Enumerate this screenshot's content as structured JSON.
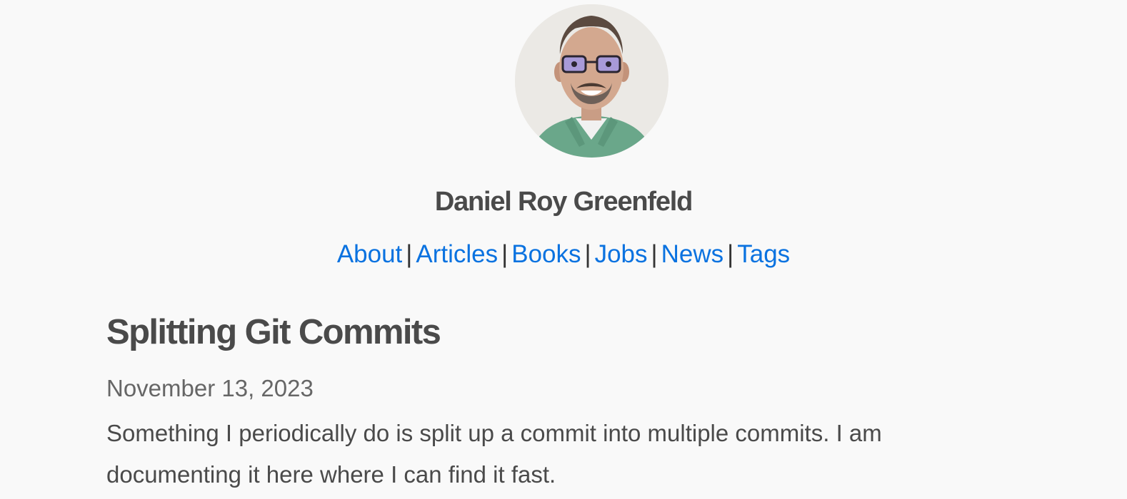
{
  "header": {
    "avatar_alt": "Daniel Roy Greenfeld",
    "site_name": "Daniel Roy Greenfeld"
  },
  "nav": {
    "items": [
      {
        "label": "About"
      },
      {
        "label": "Articles"
      },
      {
        "label": "Books"
      },
      {
        "label": "Jobs"
      },
      {
        "label": "News"
      },
      {
        "label": "Tags"
      }
    ],
    "separator": "|"
  },
  "post": {
    "title": "Splitting Git Commits",
    "date": "November 13, 2023",
    "summary": "Something I periodically do is split up a commit into multiple commits. I am documenting it here where I can find it fast."
  },
  "colors": {
    "background": "#f9f9f9",
    "link": "#0a72e0",
    "text": "#4a4a4a"
  }
}
